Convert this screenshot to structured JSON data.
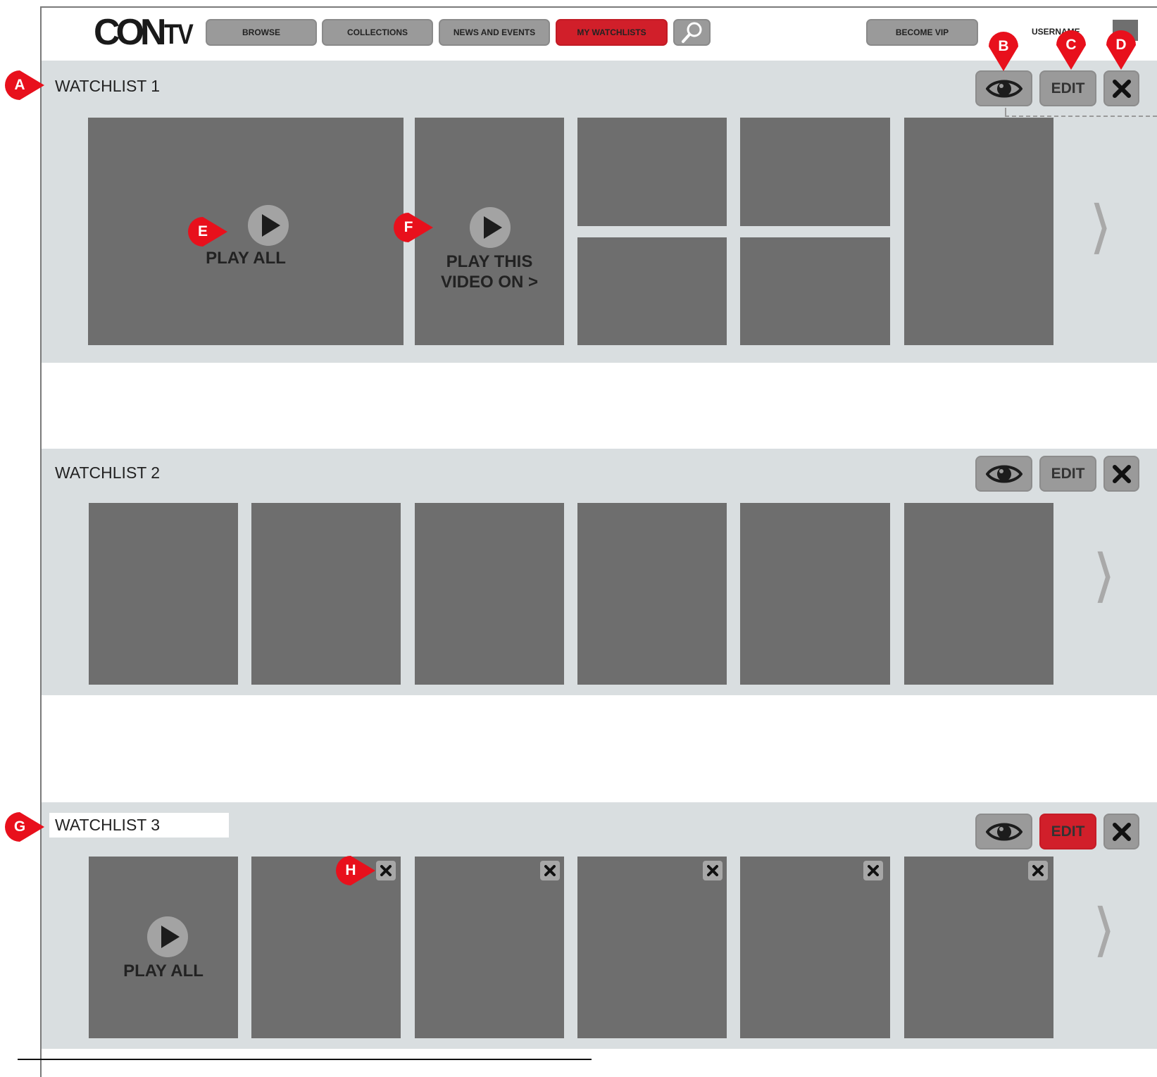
{
  "header": {
    "logo_big": "CON",
    "logo_small": "TV",
    "nav": [
      "BROWSE",
      "COLLECTIONS",
      "NEWS AND EVENTS",
      "MY WATCHLISTS"
    ],
    "active_nav": "MY WATCHLISTS",
    "become_vip": "BECOME VIP",
    "username": "USERNAME"
  },
  "colors": {
    "accent": "#d11f2a",
    "band": "#d9dee0",
    "tile": "#6e6e6e",
    "button": "#9a9a9a",
    "marker": "#e8101c"
  },
  "icons": {
    "search": "search-icon",
    "view": "eye-icon",
    "delete": "close-icon",
    "play": "play-icon",
    "next": "chevron-right-icon"
  },
  "watchlists": [
    {
      "title": "WATCHLIST 1",
      "edit_label": "EDIT",
      "play_all_label": "PLAY ALL",
      "play_this_label_1": "PLAY THIS",
      "play_this_label_2": "VIDEO ON >"
    },
    {
      "title": "WATCHLIST 2",
      "edit_label": "EDIT"
    },
    {
      "title": "WATCHLIST 3",
      "edit_label": "EDIT",
      "play_all_label": "PLAY ALL"
    }
  ],
  "annotations": [
    "A",
    "B",
    "C",
    "D",
    "E",
    "F",
    "G",
    "H"
  ]
}
